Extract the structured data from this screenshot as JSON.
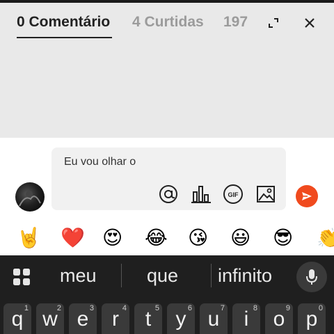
{
  "tabs": {
    "comments": "0 Comentário",
    "likes": "4 Curtidas",
    "count": "197"
  },
  "composer": {
    "text": "Eu vou olhar o",
    "tools": [
      "mention-icon",
      "poll-icon",
      "gif-icon",
      "image-icon"
    ],
    "gif_label": "GIF"
  },
  "emojis": [
    "🤘",
    "❤️",
    "😍",
    "😂",
    "😘",
    "😃",
    "😎",
    "👏"
  ],
  "keyboard": {
    "suggestions": [
      "meu",
      "que",
      "infinito"
    ],
    "keys": [
      {
        "letter": "q",
        "num": "1"
      },
      {
        "letter": "w",
        "num": "2"
      },
      {
        "letter": "e",
        "num": "3"
      },
      {
        "letter": "r",
        "num": "4"
      },
      {
        "letter": "t",
        "num": "5"
      },
      {
        "letter": "y",
        "num": "6"
      },
      {
        "letter": "u",
        "num": "7"
      },
      {
        "letter": "i",
        "num": "8"
      },
      {
        "letter": "o",
        "num": "9"
      },
      {
        "letter": "p",
        "num": "0"
      }
    ]
  },
  "colors": {
    "accent": "#f04a1e",
    "tab_inactive": "#9b9b9b",
    "keyboard_bg": "#1f1f1f"
  }
}
